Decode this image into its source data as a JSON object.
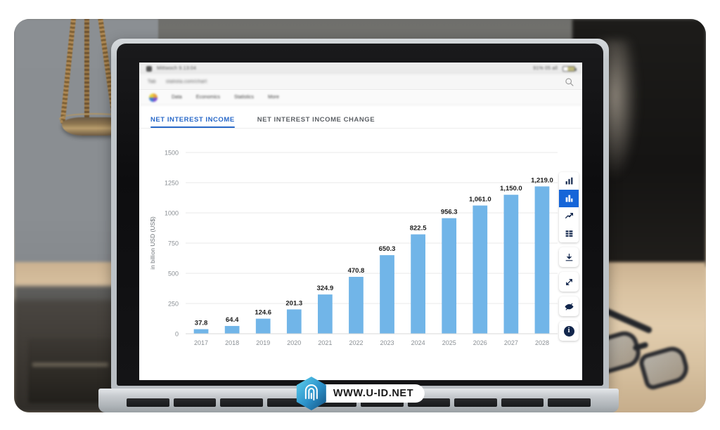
{
  "watermark": {
    "text": "WWW.U-ID.NET",
    "logo_icon": "fingerprint-hexagon-icon"
  },
  "browser": {
    "statusbar": {
      "left_text": "Mittwoch 9.13:04",
      "right_text": "91% 05 all"
    },
    "addressbar": {
      "tab_label": "Tab",
      "url_text": "statista.com/chart",
      "search_icon": "search-icon"
    },
    "navbar": {
      "logo_icon": "site-logo-icon",
      "items": [
        {
          "label": "Data"
        },
        {
          "label": "Economics"
        },
        {
          "label": "Statistics"
        },
        {
          "label": "More"
        }
      ]
    }
  },
  "tabs": [
    {
      "label": "NET INTEREST INCOME",
      "active": true
    },
    {
      "label": "NET INTEREST INCOME CHANGE",
      "active": false
    }
  ],
  "toolbar": {
    "groups": [
      {
        "buttons": [
          {
            "name": "bar-chart-icon",
            "active": false
          },
          {
            "name": "column-chart-icon",
            "active": true
          },
          {
            "name": "line-chart-icon",
            "active": false
          },
          {
            "name": "table-icon",
            "active": false
          }
        ]
      }
    ],
    "singles": [
      {
        "name": "download-icon"
      },
      {
        "name": "expand-icon"
      },
      {
        "name": "hide-eye-icon"
      },
      {
        "name": "info-icon",
        "label": "i"
      }
    ]
  },
  "chart_data": {
    "type": "bar",
    "title": "",
    "xlabel": "",
    "ylabel": "in billion USD (US$)",
    "ylim": [
      0,
      1500
    ],
    "yticks": [
      0,
      250,
      500,
      750,
      1000,
      1250,
      1500
    ],
    "ytick_labels": [
      "0",
      "250",
      "500",
      "750",
      "1000",
      "1250",
      "1500"
    ],
    "grid": true,
    "legend": "none",
    "bar_color": "#71b5e8",
    "categories": [
      "2017",
      "2018",
      "2019",
      "2020",
      "2021",
      "2022",
      "2023",
      "2024",
      "2025",
      "2026",
      "2027",
      "2028"
    ],
    "values": [
      37.8,
      64.4,
      124.6,
      201.3,
      324.9,
      470.8,
      650.3,
      822.5,
      956.3,
      1061.0,
      1150.0,
      1219.0
    ],
    "data_labels": [
      "37.8",
      "64.4",
      "124.6",
      "201.3",
      "324.9",
      "470.8",
      "650.3",
      "822.5",
      "956.3",
      "1,061.0",
      "1,150.0",
      "1,219.0"
    ]
  },
  "colors": {
    "accent": "#2868c8",
    "toolbar_active": "#1565d8",
    "bar": "#71b5e8",
    "grid": "#e8e8e8",
    "axis_text": "#8a8f94",
    "label_text": "#1c1c1c"
  }
}
